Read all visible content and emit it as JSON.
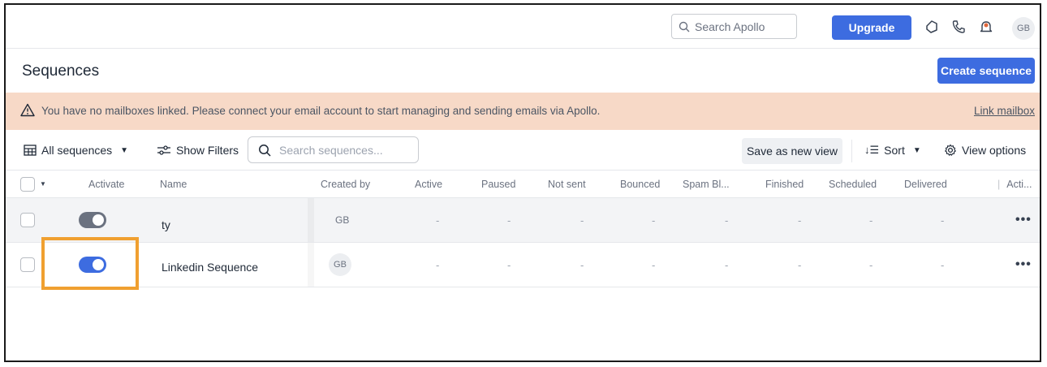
{
  "topbar": {
    "search_placeholder": "Search Apollo",
    "upgrade_label": "Upgrade",
    "avatar_initials": "GB"
  },
  "page": {
    "title": "Sequences",
    "create_label": "Create sequence"
  },
  "banner": {
    "message": "You have no mailboxes linked. Please connect your email account to start managing and sending emails via Apollo.",
    "link_label": "Link mailbox"
  },
  "toolbar": {
    "view_label": "All sequences",
    "filters_label": "Show Filters",
    "search_placeholder": "Search sequences...",
    "save_view_label": "Save as new view",
    "sort_label": "Sort",
    "view_options_label": "View options"
  },
  "table": {
    "headers": {
      "activate": "Activate",
      "name": "Name",
      "created_by": "Created by",
      "active": "Active",
      "paused": "Paused",
      "not_sent": "Not sent",
      "bounced": "Bounced",
      "spam": "Spam Bl...",
      "finished": "Finished",
      "scheduled": "Scheduled",
      "delivered": "Delivered",
      "actions": "Acti..."
    },
    "rows": [
      {
        "name": "ty",
        "active": false,
        "created_by": "GB",
        "dash": "-"
      },
      {
        "name": "Linkedin Sequence",
        "active": true,
        "created_by": "GB",
        "dash": "-"
      }
    ],
    "more": "•••"
  },
  "colors": {
    "primary": "#3d6ce0",
    "banner_bg": "#f7d9c7",
    "highlight": "#f0a030"
  }
}
